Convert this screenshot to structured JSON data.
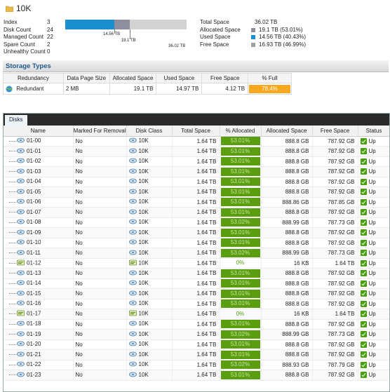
{
  "header": {
    "title": "10K",
    "icon": "folder-icon"
  },
  "summary": {
    "left": [
      {
        "label": "Index",
        "value": "3"
      },
      {
        "label": "Disk Count",
        "value": "24"
      },
      {
        "label": "Managed Count",
        "value": "22"
      },
      {
        "label": "Spare Count",
        "value": "2"
      },
      {
        "label": "Unhealthy Count",
        "value": "0"
      }
    ],
    "bar": {
      "used_fraction": 0.4043,
      "allocated_fraction": 0.5301,
      "used_label": "14.56 TB",
      "allocated_label": "19.1 TB",
      "total_label": "36.02 TB",
      "used_color": "#1a8fd0",
      "allocated_color": "#8e8e9c",
      "free_color": "#d2d2d2"
    },
    "right": [
      {
        "label": "Total Space",
        "value": "36.02 TB",
        "swatch": ""
      },
      {
        "label": "Allocated Space",
        "value": "19.1 TB (53.01%)",
        "swatch": "#8e8e9c"
      },
      {
        "label": "Used Space",
        "value": "14.56 TB (40.43%)",
        "swatch": "#1a8fd0"
      },
      {
        "label": "Free Space",
        "value": "16.93 TB (46.99%)",
        "swatch": "#a0a0a0"
      }
    ]
  },
  "storage_types": {
    "heading": "Storage Types",
    "columns": [
      "Redundancy",
      "Data Page Size",
      "Allocated Space",
      "Used Space",
      "Free Space",
      "% Full"
    ],
    "row": {
      "redundancy": "Redundant",
      "page_size": "2 MB",
      "allocated": "19.1 TB",
      "used": "14.97 TB",
      "free": "4.12 TB",
      "full": "78.4%",
      "full_color": "#f7a81c"
    }
  },
  "disks": {
    "tab": "Disks",
    "columns": [
      "Name",
      "Marked For Removal",
      "Disk Class",
      "Total Space",
      "% Allocated",
      "Allocated Space",
      "Free Space",
      "Status"
    ],
    "rows": [
      {
        "name": "01-00",
        "removal": "No",
        "class": "10K",
        "total": "1.64 TB",
        "pct": "53.01%",
        "alloc": "888.8 GB",
        "free": "787.92 GB",
        "status": "Up",
        "spare": false
      },
      {
        "name": "01-01",
        "removal": "No",
        "class": "10K",
        "total": "1.64 TB",
        "pct": "53.01%",
        "alloc": "888.8 GB",
        "free": "787.92 GB",
        "status": "Up",
        "spare": false
      },
      {
        "name": "01-02",
        "removal": "No",
        "class": "10K",
        "total": "1.64 TB",
        "pct": "53.01%",
        "alloc": "888.8 GB",
        "free": "787.92 GB",
        "status": "Up",
        "spare": false
      },
      {
        "name": "01-03",
        "removal": "No",
        "class": "10K",
        "total": "1.64 TB",
        "pct": "53.01%",
        "alloc": "888.8 GB",
        "free": "787.92 GB",
        "status": "Up",
        "spare": false
      },
      {
        "name": "01-04",
        "removal": "No",
        "class": "10K",
        "total": "1.64 TB",
        "pct": "53.01%",
        "alloc": "888.8 GB",
        "free": "787.92 GB",
        "status": "Up",
        "spare": false
      },
      {
        "name": "01-05",
        "removal": "No",
        "class": "10K",
        "total": "1.64 TB",
        "pct": "53.01%",
        "alloc": "888.8 GB",
        "free": "787.92 GB",
        "status": "Up",
        "spare": false
      },
      {
        "name": "01-06",
        "removal": "No",
        "class": "10K",
        "total": "1.64 TB",
        "pct": "53.01%",
        "alloc": "888.86 GB",
        "free": "787.85 GB",
        "status": "Up",
        "spare": false
      },
      {
        "name": "01-07",
        "removal": "No",
        "class": "10K",
        "total": "1.64 TB",
        "pct": "53.01%",
        "alloc": "888.8 GB",
        "free": "787.92 GB",
        "status": "Up",
        "spare": false
      },
      {
        "name": "01-08",
        "removal": "No",
        "class": "10K",
        "total": "1.64 TB",
        "pct": "53.02%",
        "alloc": "888.99 GB",
        "free": "787.73 GB",
        "status": "Up",
        "spare": false
      },
      {
        "name": "01-09",
        "removal": "No",
        "class": "10K",
        "total": "1.64 TB",
        "pct": "53.01%",
        "alloc": "888.8 GB",
        "free": "787.92 GB",
        "status": "Up",
        "spare": false
      },
      {
        "name": "01-10",
        "removal": "No",
        "class": "10K",
        "total": "1.64 TB",
        "pct": "53.01%",
        "alloc": "888.8 GB",
        "free": "787.92 GB",
        "status": "Up",
        "spare": false
      },
      {
        "name": "01-11",
        "removal": "No",
        "class": "10K",
        "total": "1.64 TB",
        "pct": "53.02%",
        "alloc": "888.99 GB",
        "free": "787.73 GB",
        "status": "Up",
        "spare": false
      },
      {
        "name": "01-12",
        "removal": "No",
        "class": "10K",
        "total": "1.64 TB",
        "pct": "0%",
        "alloc": "16 KB",
        "free": "1.64 TB",
        "status": "Up",
        "spare": true
      },
      {
        "name": "01-13",
        "removal": "No",
        "class": "10K",
        "total": "1.64 TB",
        "pct": "53.01%",
        "alloc": "888.8 GB",
        "free": "787.92 GB",
        "status": "Up",
        "spare": false
      },
      {
        "name": "01-14",
        "removal": "No",
        "class": "10K",
        "total": "1.64 TB",
        "pct": "53.01%",
        "alloc": "888.8 GB",
        "free": "787.92 GB",
        "status": "Up",
        "spare": false
      },
      {
        "name": "01-15",
        "removal": "No",
        "class": "10K",
        "total": "1.64 TB",
        "pct": "53.01%",
        "alloc": "888.8 GB",
        "free": "787.92 GB",
        "status": "Up",
        "spare": false
      },
      {
        "name": "01-16",
        "removal": "No",
        "class": "10K",
        "total": "1.64 TB",
        "pct": "53.01%",
        "alloc": "888.8 GB",
        "free": "787.92 GB",
        "status": "Up",
        "spare": false
      },
      {
        "name": "01-17",
        "removal": "No",
        "class": "10K",
        "total": "1.64 TB",
        "pct": "0%",
        "alloc": "16 KB",
        "free": "1.64 TB",
        "status": "Up",
        "spare": true
      },
      {
        "name": "01-18",
        "removal": "No",
        "class": "10K",
        "total": "1.64 TB",
        "pct": "53.01%",
        "alloc": "888.8 GB",
        "free": "787.92 GB",
        "status": "Up",
        "spare": false
      },
      {
        "name": "01-19",
        "removal": "No",
        "class": "10K",
        "total": "1.64 TB",
        "pct": "53.02%",
        "alloc": "888.99 GB",
        "free": "787.73 GB",
        "status": "Up",
        "spare": false
      },
      {
        "name": "01-20",
        "removal": "No",
        "class": "10K",
        "total": "1.64 TB",
        "pct": "53.01%",
        "alloc": "888.8 GB",
        "free": "787.92 GB",
        "status": "Up",
        "spare": false
      },
      {
        "name": "01-21",
        "removal": "No",
        "class": "10K",
        "total": "1.64 TB",
        "pct": "53.01%",
        "alloc": "888.8 GB",
        "free": "787.92 GB",
        "status": "Up",
        "spare": false
      },
      {
        "name": "01-22",
        "removal": "No",
        "class": "10K",
        "total": "1.64 TB",
        "pct": "53.02%",
        "alloc": "888.93 GB",
        "free": "787.79 GB",
        "status": "Up",
        "spare": false
      },
      {
        "name": "01-23",
        "removal": "No",
        "class": "10K",
        "total": "1.64 TB",
        "pct": "53.01%",
        "alloc": "888.8 GB",
        "free": "787.92 GB",
        "status": "Up",
        "spare": false
      }
    ]
  }
}
